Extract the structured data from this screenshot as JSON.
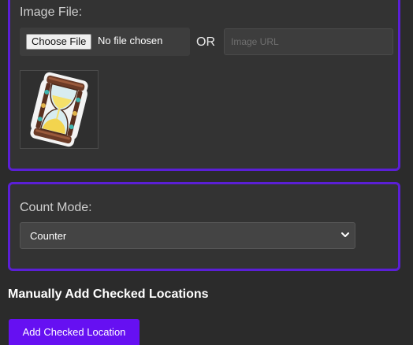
{
  "image_file": {
    "label": "Image File:",
    "choose_button": "Choose File",
    "file_status": "No file chosen",
    "or_text": "OR",
    "url_placeholder": "Image URL",
    "preview_icon": "hourglass-icon"
  },
  "count_mode": {
    "label": "Count Mode:",
    "selected": "Counter",
    "chevron_icon": "chevron-down-icon"
  },
  "manual_checks": {
    "heading": "Manually Add Checked Locations",
    "add_button": "Add Checked Location"
  },
  "colors": {
    "background": "#2b2b2b",
    "panel": "#333333",
    "panel_border": "#5b1fd6",
    "primary_button": "#6610f2"
  }
}
